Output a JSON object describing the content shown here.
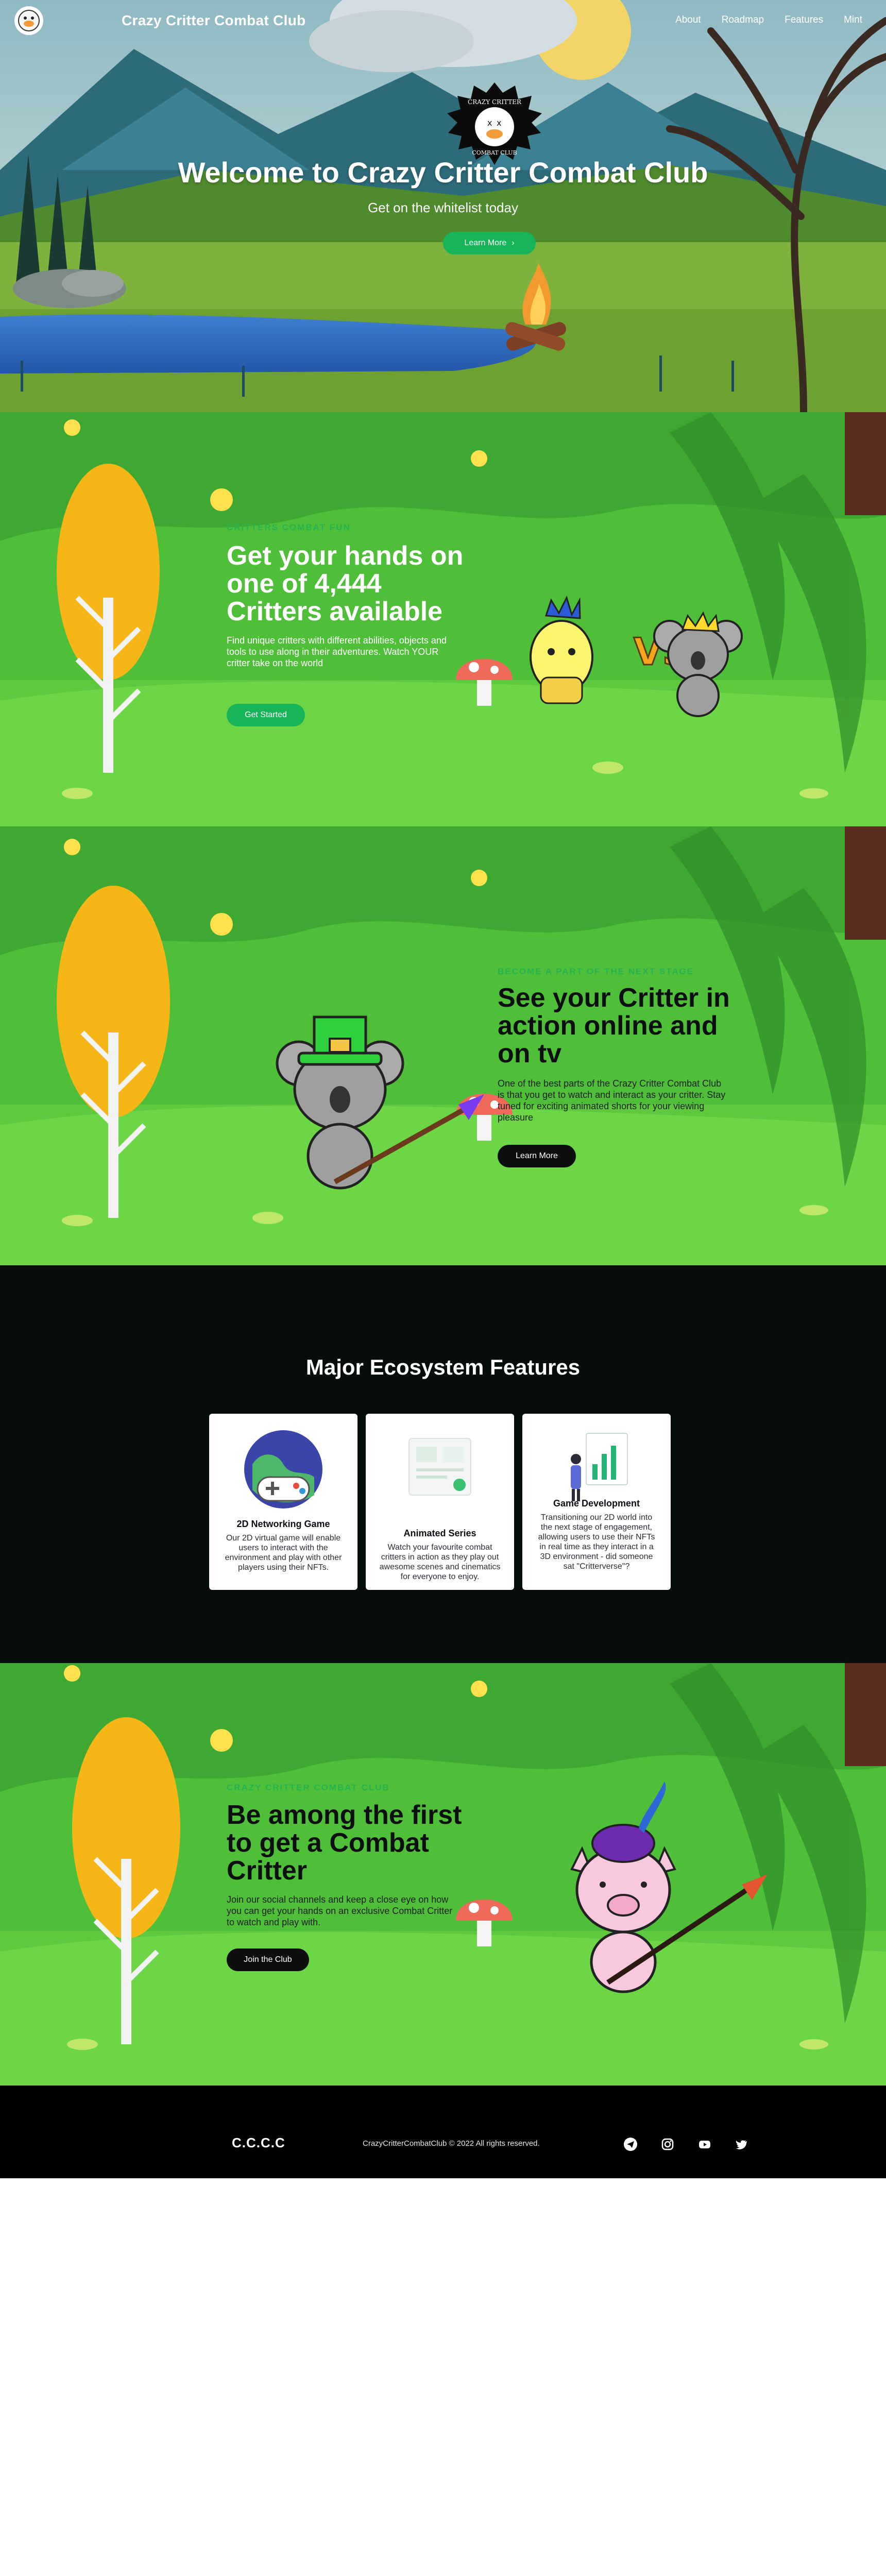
{
  "nav": {
    "brand": "Crazy Critter Combat Club",
    "links": [
      "About",
      "Roadmap",
      "Features",
      "Mint"
    ]
  },
  "hero": {
    "emblem_text_top": "CRAZY CRITTER",
    "emblem_text_bottom": "COMBAT CLUB",
    "title": "Welcome to Crazy Critter Combat Club",
    "subtitle": "Get on the whitelist today",
    "cta": "Learn More",
    "cta_icon": "chevron-right-icon"
  },
  "section1": {
    "eyebrow": "CRITTERS COMBAT FUN",
    "title_lines": [
      "Get your hands on",
      "one of 4,444",
      "Critters available"
    ],
    "body": "Find unique critters with different abilities, objects and tools to use along in their adventures. Watch YOUR critter take on the world",
    "cta": "Get Started",
    "vs": "VS"
  },
  "section2": {
    "eyebrow": "BECOME A PART OF THE NEXT STAGE",
    "title_lines": [
      "See your Critter in",
      "action online and",
      "on tv"
    ],
    "body": "One of the best parts of the Crazy Critter Combat Club is that you get to watch and interact as your critter. Stay tuned for exciting animated shorts for your viewing pleasure",
    "cta": "Learn More"
  },
  "features": {
    "title": "Major Ecosystem Features",
    "cards": [
      {
        "title": "2D Networking Game",
        "desc": "Our 2D virtual game will enable users to interact with the environment and play with other players using their NFTs.",
        "icon": "game-controller-globe-icon"
      },
      {
        "title": "Animated Series",
        "desc": "Watch your favourite combat critters in action as they play out awesome scenes and cinematics for everyone to enjoy.",
        "icon": "animation-storyboard-icon"
      },
      {
        "title": "Game Development",
        "desc": "Transitioning our 2D world into the next stage of engagement, allowing users to use their NFTs in real time as they interact in a 3D environment - did someone sat \"Critterverse\"?",
        "icon": "development-chart-icon"
      }
    ]
  },
  "section3": {
    "eyebrow": "CRAZY CRITTER COMBAT CLUB",
    "title_lines": [
      "Be among the first",
      "to get a Combat",
      "Critter"
    ],
    "body": "Join our social channels and keep a close eye on how you can get your hands on an exclusive Combat Critter to watch and play with.",
    "cta": "Join the Club"
  },
  "footer": {
    "brand": "C.C.C.C",
    "copyright": "CrazyCritterCombatClub © 2022 All rights reserved.",
    "social": [
      "telegram-icon",
      "instagram-icon",
      "youtube-icon",
      "twitter-icon"
    ]
  },
  "colors": {
    "accent_green": "#17b45a",
    "eyebrow_green": "#27b34e",
    "dark_button": "#0d0f0f",
    "features_bg": "#070c0d"
  }
}
